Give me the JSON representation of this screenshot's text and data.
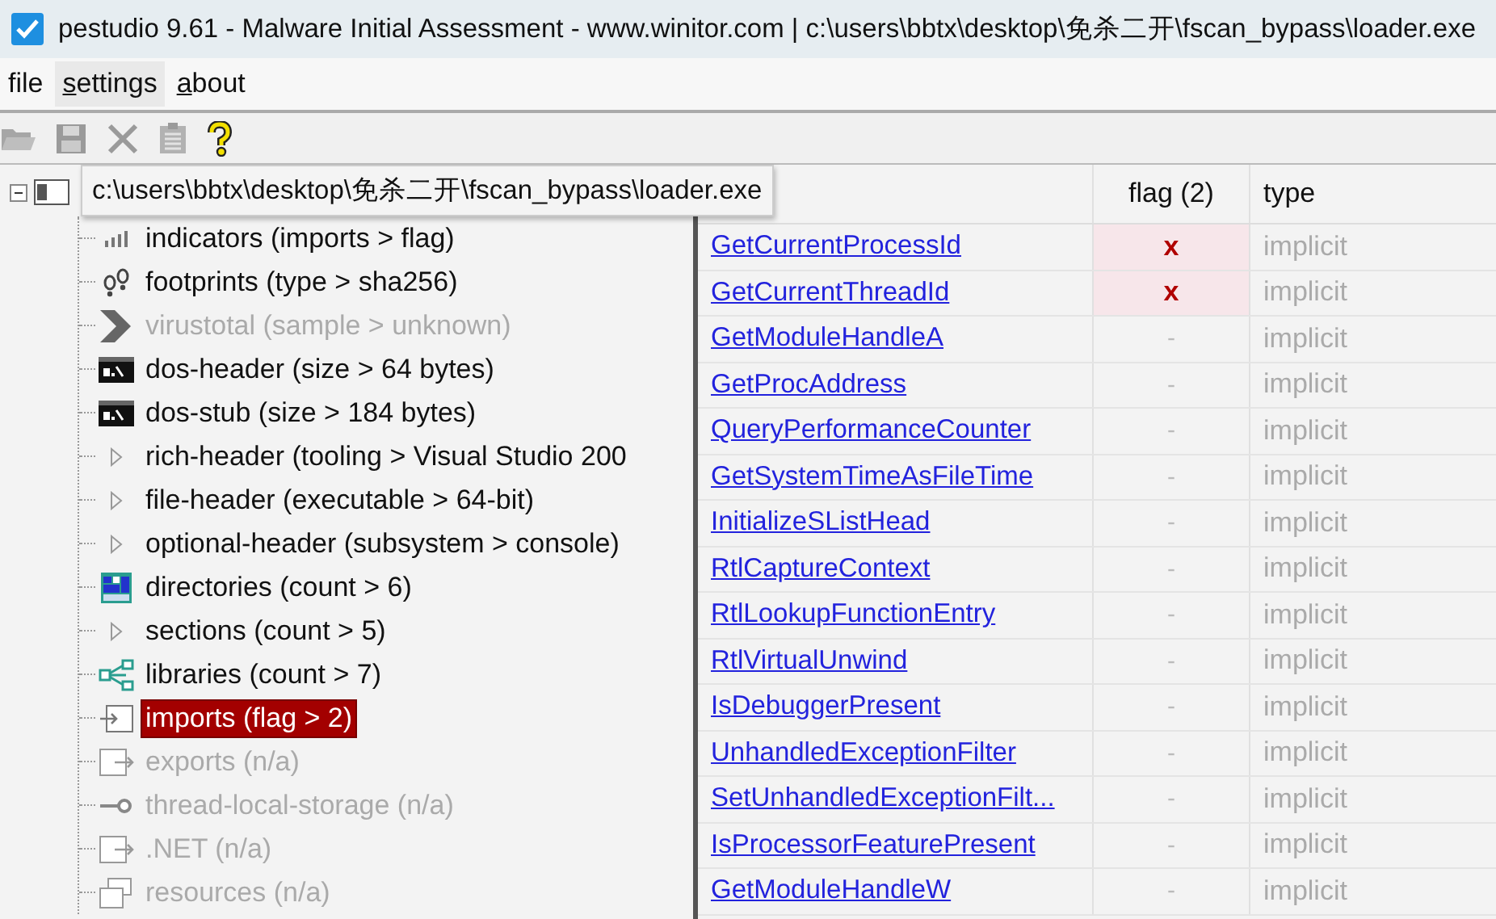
{
  "window": {
    "title": "pestudio 9.61 - Malware Initial Assessment - www.winitor.com | c:\\users\\bbtx\\desktop\\免杀二开\\fscan_bypass\\loader.exe"
  },
  "menu": [
    {
      "label": "file",
      "mnemonic": false,
      "hovered": false
    },
    {
      "label": "settings",
      "mnemonic": true,
      "hovered": true
    },
    {
      "label": "about",
      "mnemonic": true,
      "hovered": false
    }
  ],
  "toolbar": [
    {
      "kind": "open",
      "disabled": true
    },
    {
      "kind": "save",
      "disabled": true
    },
    {
      "kind": "cut",
      "disabled": true
    },
    {
      "kind": "clipboard",
      "disabled": true
    },
    {
      "kind": "help",
      "disabled": false
    }
  ],
  "tooltip": "c:\\users\\bbtx\\desktop\\免杀二开\\fscan_bypass\\loader.exe",
  "tree": {
    "root": {
      "expanded": true
    },
    "children": [
      {
        "kind": "indicators",
        "label": "indicators (imports > flag)",
        "disabled": false,
        "selected": false
      },
      {
        "kind": "footprints",
        "label": "footprints (type > sha256)",
        "disabled": false,
        "selected": false
      },
      {
        "kind": "virustotal",
        "label": "virustotal (sample > unknown)",
        "disabled": true,
        "selected": false
      },
      {
        "kind": "console",
        "label": "dos-header (size > 64 bytes)",
        "disabled": false,
        "selected": false
      },
      {
        "kind": "console",
        "label": "dos-stub (size > 184 bytes)",
        "disabled": false,
        "selected": false
      },
      {
        "kind": "expander",
        "label": "rich-header (tooling > Visual Studio 200",
        "disabled": false,
        "selected": false
      },
      {
        "kind": "expander",
        "label": "file-header (executable > 64-bit)",
        "disabled": false,
        "selected": false
      },
      {
        "kind": "expander",
        "label": "optional-header (subsystem > console)",
        "disabled": false,
        "selected": false
      },
      {
        "kind": "directories",
        "label": "directories (count > 6)",
        "disabled": false,
        "selected": false
      },
      {
        "kind": "expander",
        "label": "sections (count > 5)",
        "disabled": false,
        "selected": false
      },
      {
        "kind": "libraries",
        "label": "libraries (count > 7)",
        "disabled": false,
        "selected": false
      },
      {
        "kind": "imports",
        "label": "imports (flag > 2)",
        "disabled": false,
        "selected": true
      },
      {
        "kind": "exports",
        "label": "exports (n/a)",
        "disabled": true,
        "selected": false
      },
      {
        "kind": "tls",
        "label": "thread-local-storage (n/a)",
        "disabled": true,
        "selected": false
      },
      {
        "kind": "exports",
        "label": ".NET (n/a)",
        "disabled": true,
        "selected": false
      },
      {
        "kind": "resources",
        "label": "resources (n/a)",
        "disabled": true,
        "selected": false
      }
    ]
  },
  "table": {
    "columns": [
      "flag (2)",
      "type"
    ],
    "rows": [
      {
        "name": "GetCurrentProcessId",
        "flag": "x",
        "flagged": true,
        "type": "implicit"
      },
      {
        "name": "GetCurrentThreadId",
        "flag": "x",
        "flagged": true,
        "type": "implicit"
      },
      {
        "name": "GetModuleHandleA",
        "flag": "-",
        "flagged": false,
        "type": "implicit"
      },
      {
        "name": "GetProcAddress",
        "flag": "-",
        "flagged": false,
        "type": "implicit"
      },
      {
        "name": "QueryPerformanceCounter",
        "flag": "-",
        "flagged": false,
        "type": "implicit"
      },
      {
        "name": "GetSystemTimeAsFileTime",
        "flag": "-",
        "flagged": false,
        "type": "implicit"
      },
      {
        "name": "InitializeSListHead",
        "flag": "-",
        "flagged": false,
        "type": "implicit"
      },
      {
        "name": "RtlCaptureContext",
        "flag": "-",
        "flagged": false,
        "type": "implicit"
      },
      {
        "name": "RtlLookupFunctionEntry",
        "flag": "-",
        "flagged": false,
        "type": "implicit"
      },
      {
        "name": "RtlVirtualUnwind",
        "flag": "-",
        "flagged": false,
        "type": "implicit"
      },
      {
        "name": "IsDebuggerPresent",
        "flag": "-",
        "flagged": false,
        "type": "implicit"
      },
      {
        "name": "UnhandledExceptionFilter",
        "flag": "-",
        "flagged": false,
        "type": "implicit"
      },
      {
        "name": "SetUnhandledExceptionFilt...",
        "flag": "-",
        "flagged": false,
        "type": "implicit"
      },
      {
        "name": "IsProcessorFeaturePresent",
        "flag": "-",
        "flagged": false,
        "type": "implicit"
      },
      {
        "name": "GetModuleHandleW",
        "flag": "-",
        "flagged": false,
        "type": "implicit"
      }
    ]
  }
}
